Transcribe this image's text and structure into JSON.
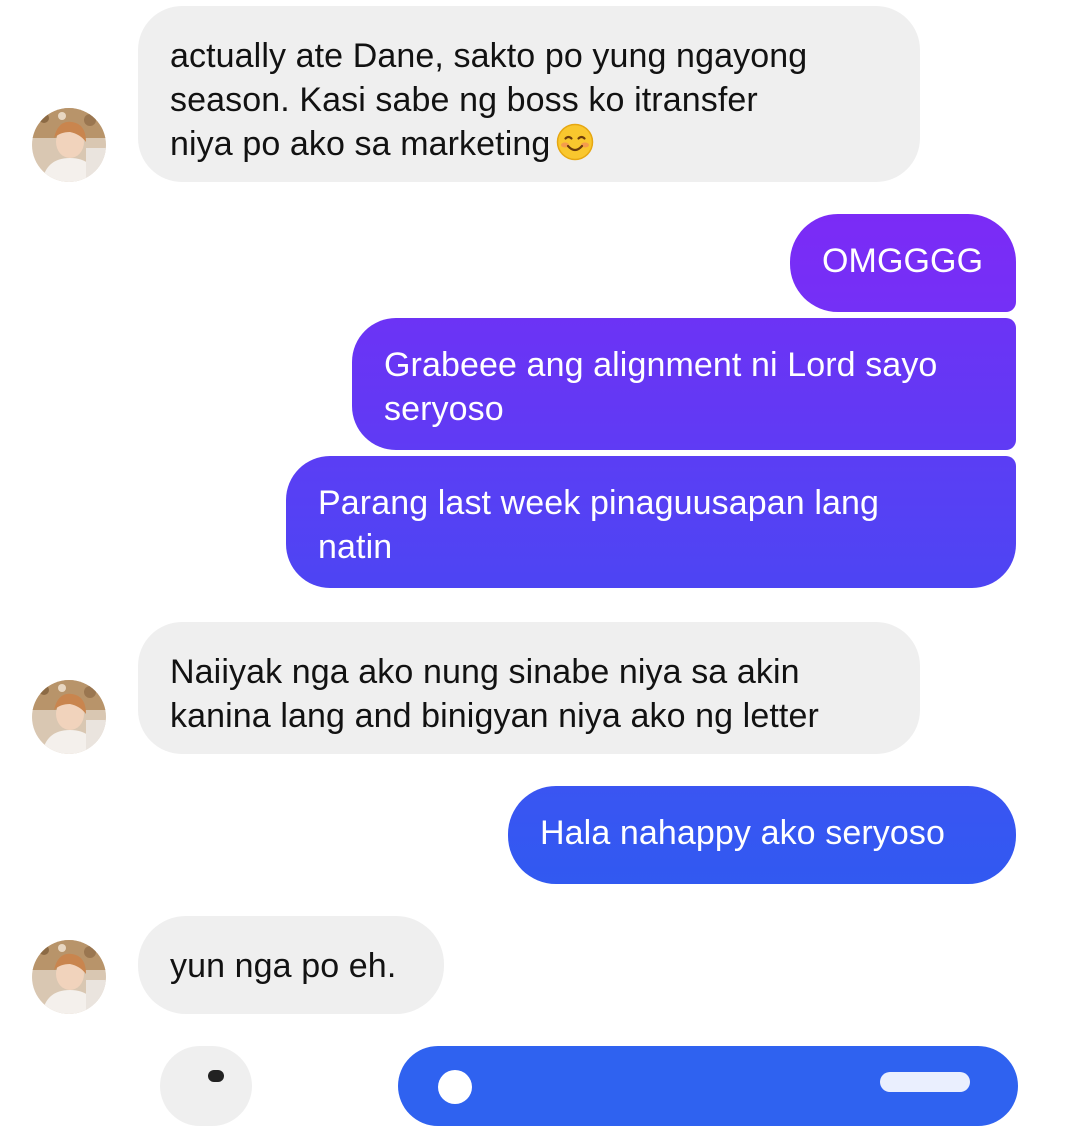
{
  "messages": [
    {
      "id": "m1",
      "sender": "contact",
      "lines": [
        "actually ate Dane, sakto po yung ngayong",
        "season. Kasi sabe ng boss ko itransfer",
        "niya po ako sa marketing"
      ],
      "emoji": "smiling-face-icon"
    },
    {
      "id": "m2",
      "sender": "me",
      "lines": [
        "OMGGGG"
      ]
    },
    {
      "id": "m3",
      "sender": "me",
      "lines": [
        "Grabeee ang alignment ni Lord sayo",
        "seryoso"
      ]
    },
    {
      "id": "m4",
      "sender": "me",
      "lines": [
        "Parang last week pinaguusapan lang",
        "natin"
      ]
    },
    {
      "id": "m5",
      "sender": "contact",
      "lines": [
        "Naiiyak nga ako nung sinabe niya sa akin",
        "kanina lang and binigyan niya ako ng letter"
      ]
    },
    {
      "id": "m6",
      "sender": "me",
      "lines": [
        "Hala nahappy ako seryoso"
      ]
    },
    {
      "id": "m7",
      "sender": "contact",
      "lines": [
        "yun nga po eh."
      ]
    }
  ],
  "colors": {
    "incoming_bg": "#efefef",
    "incoming_text": "#121212",
    "outgoing_text": "#ffffff",
    "gradient_top": "#7a2cf6",
    "gradient_bottom": "#3156f1"
  },
  "icons": {
    "avatar": "contact-avatar-photo",
    "emoji": "smiling-face-icon"
  }
}
